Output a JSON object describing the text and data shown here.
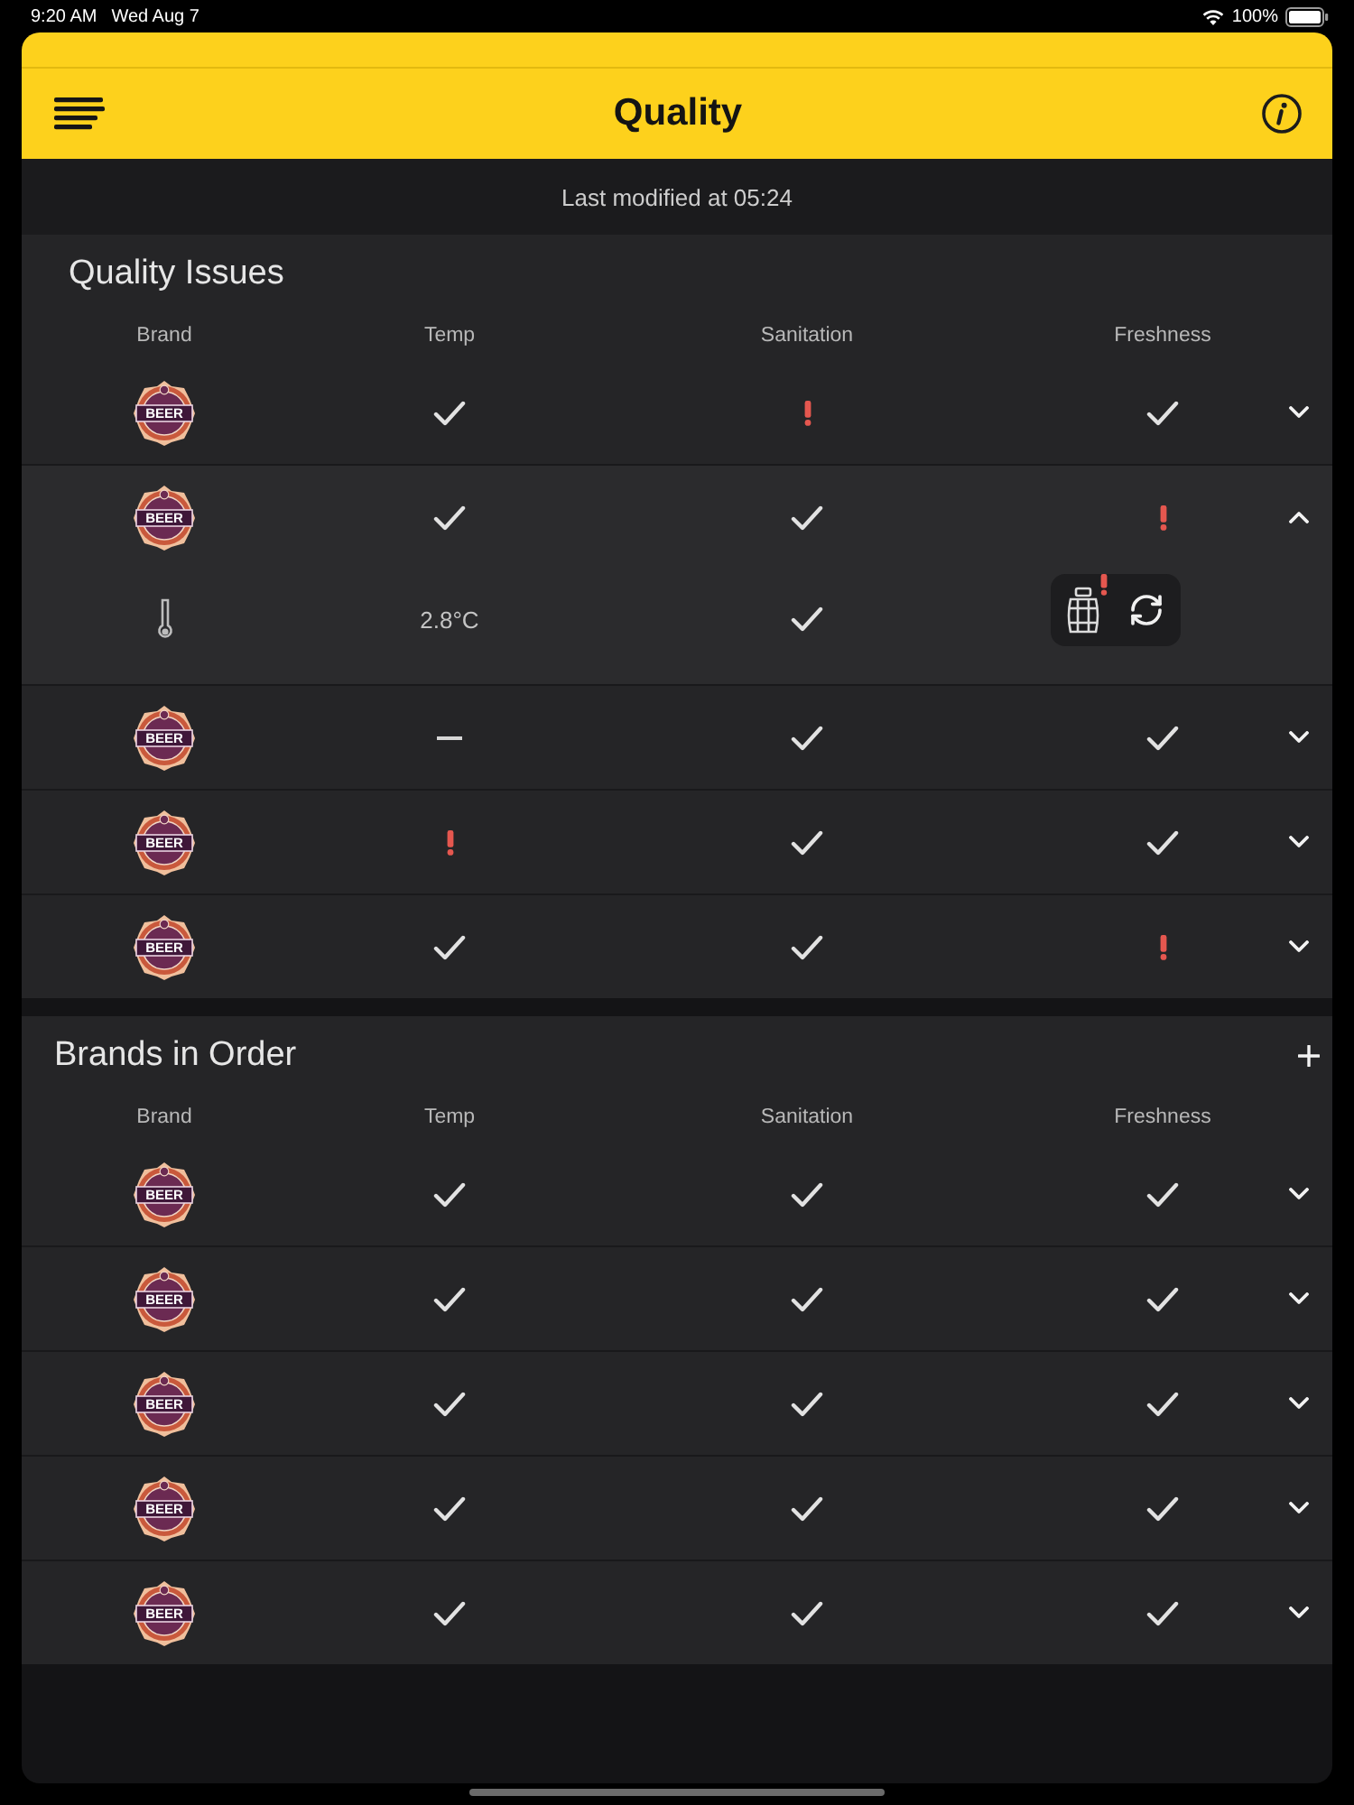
{
  "status_bar": {
    "time": "9:20 AM",
    "date": "Wed Aug 7",
    "battery": "100%"
  },
  "header": {
    "title": "Quality"
  },
  "last_modified": "Last modified at 05:24",
  "sections": [
    {
      "title": "Quality Issues",
      "addable": false,
      "columns": [
        "Brand",
        "Temp",
        "Sanitation",
        "Freshness"
      ],
      "rows": [
        {
          "logo_text": "BEER",
          "expanded": false,
          "cells": [
            {
              "kind": "check"
            },
            {
              "kind": "alert"
            },
            {
              "kind": "check"
            }
          ]
        },
        {
          "logo_text": "BEER",
          "expanded": true,
          "cells": [
            {
              "kind": "check"
            },
            {
              "kind": "check"
            },
            {
              "kind": "alert"
            }
          ],
          "detail": {
            "reading": "2.8°C",
            "sanitation": {
              "kind": "check"
            },
            "keg_alert": true
          }
        },
        {
          "logo_text": "BEER",
          "expanded": false,
          "cells": [
            {
              "kind": "dash"
            },
            {
              "kind": "check"
            },
            {
              "kind": "check"
            }
          ]
        },
        {
          "logo_text": "BEER",
          "expanded": false,
          "cells": [
            {
              "kind": "alert"
            },
            {
              "kind": "check"
            },
            {
              "kind": "check"
            }
          ]
        },
        {
          "logo_text": "BEER",
          "expanded": false,
          "cells": [
            {
              "kind": "check"
            },
            {
              "kind": "check"
            },
            {
              "kind": "alert"
            }
          ]
        }
      ]
    },
    {
      "title": "Brands in Order",
      "addable": true,
      "columns": [
        "Brand",
        "Temp",
        "Sanitation",
        "Freshness"
      ],
      "rows": [
        {
          "logo_text": "BEER",
          "expanded": false,
          "cells": [
            {
              "kind": "check"
            },
            {
              "kind": "check"
            },
            {
              "kind": "check"
            }
          ]
        },
        {
          "logo_text": "BEER",
          "expanded": false,
          "cells": [
            {
              "kind": "check"
            },
            {
              "kind": "check"
            },
            {
              "kind": "check"
            }
          ]
        },
        {
          "logo_text": "BEER",
          "expanded": false,
          "cells": [
            {
              "kind": "check"
            },
            {
              "kind": "check"
            },
            {
              "kind": "check"
            }
          ]
        },
        {
          "logo_text": "BEER",
          "expanded": false,
          "cells": [
            {
              "kind": "check"
            },
            {
              "kind": "check"
            },
            {
              "kind": "check"
            }
          ]
        },
        {
          "logo_text": "BEER",
          "expanded": false,
          "cells": [
            {
              "kind": "check"
            },
            {
              "kind": "check"
            },
            {
              "kind": "check"
            }
          ]
        }
      ]
    }
  ]
}
